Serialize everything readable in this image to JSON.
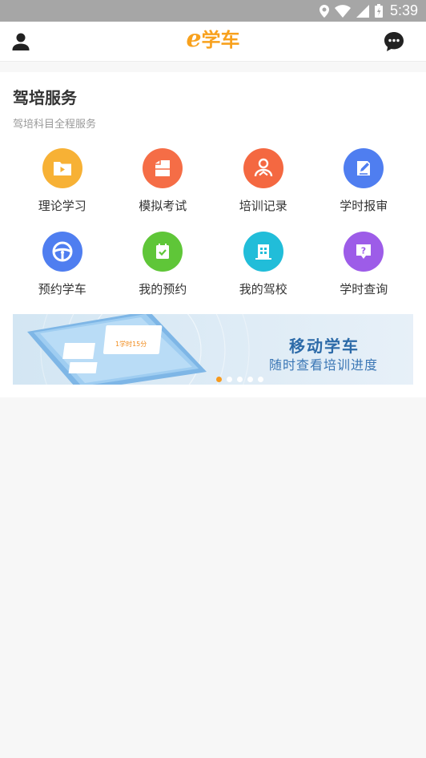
{
  "status_bar": {
    "time": "5:39"
  },
  "app_bar": {
    "logo_letter": "e",
    "logo_text": "学车"
  },
  "section": {
    "title": "驾培服务",
    "subtitle": "驾培科目全程服务"
  },
  "services": [
    {
      "label": "理论学习",
      "icon": "folder-play-icon",
      "color": "#f7b135"
    },
    {
      "label": "模拟考试",
      "icon": "exam-paper-icon",
      "color": "#f56d46"
    },
    {
      "label": "培训记录",
      "icon": "driver-icon",
      "color": "#f46841"
    },
    {
      "label": "学时报审",
      "icon": "edit-document-icon",
      "color": "#4f7ef0"
    },
    {
      "label": "预约学车",
      "icon": "steering-wheel-icon",
      "color": "#4f7ef0"
    },
    {
      "label": "我的预约",
      "icon": "calendar-check-icon",
      "color": "#5fc638"
    },
    {
      "label": "我的驾校",
      "icon": "building-icon",
      "color": "#21bdd9"
    },
    {
      "label": "学时查询",
      "icon": "question-bubble-icon",
      "color": "#9d5ce8"
    }
  ],
  "banner": {
    "title": "移动学车",
    "subtitle": "随时查看培训进度",
    "phone_text": "1学时15分",
    "slide_count": 5,
    "active_slide": 1
  }
}
